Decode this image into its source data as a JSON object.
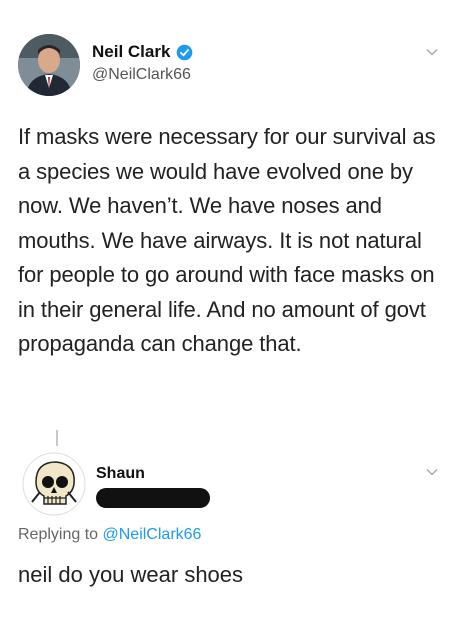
{
  "tweet": {
    "author": {
      "name": "Neil Clark",
      "handle": "@NeilClark66",
      "verified": true
    },
    "text": "If masks were necessary for our survival as a species we would have evolved one by now. We haven’t. We have noses and mouths. We have airways. It is not natural for people to go around with face masks on in their general life. And no amount of govt propaganda can change that."
  },
  "reply": {
    "author": {
      "name": "Shaun"
    },
    "replying_to_label": "Replying to",
    "replying_to_handle": "@NeilClark66",
    "text": "neil do you wear shoes"
  },
  "colors": {
    "accent": "#1d9bf0",
    "verified": "#1d9bf0",
    "muted_text": "#666666"
  }
}
